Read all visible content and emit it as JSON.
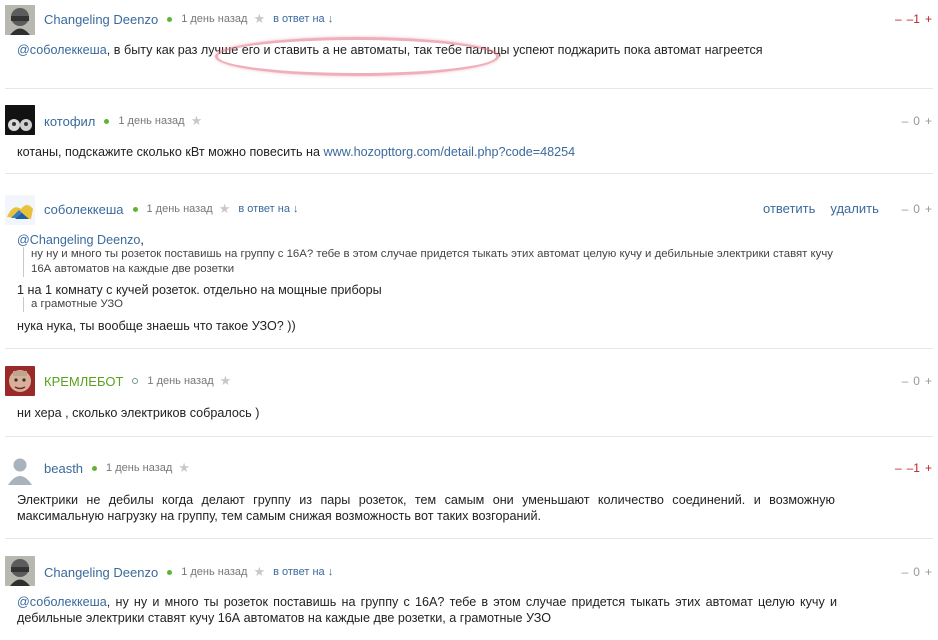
{
  "comments": [
    {
      "author": "Changeling Deenzo",
      "time": "1 день назад",
      "reply_label": "в ответ на ↓",
      "rating": "–1",
      "minus": "–",
      "plus": "+",
      "mention": "@соболеккеша",
      "text": ", в быту как раз лучше его и ставить а не автоматы, так тебе пальцы успеют поджарить пока автомат нагреется"
    },
    {
      "author": "котофил",
      "time": "1 день назад",
      "rating": "0",
      "minus": "–",
      "plus": "+",
      "text": "котаны, подскажите сколько кВт можно повесить на ",
      "link": "www.hozopttorg.com/detail.php?code=48254"
    },
    {
      "author": "соболеккеша",
      "time": "1 день назад",
      "reply_label": "в ответ на ↓",
      "reply_action": "ответить",
      "delete_action": "удалить",
      "rating": "0",
      "minus": "–",
      "plus": "+",
      "mention": "@Changeling Deenzo",
      "quote1": "ну ну и много ты розеток поставишь на группу с 16А? тебе в этом случае придется тыкать этих автомат целую кучу и дебильные электрики ставят кучу 16А автоматов на каждые две розетки",
      "line2": "1 на 1 комнату с кучей розеток. отдельно на мощные приборы",
      "quote2": "а грамотные УЗО",
      "line3": "нука нука, ты вообще знаешь что такое УЗО? ))"
    },
    {
      "author": "КРЕМЛЕБОТ",
      "time": "1 день назад",
      "rating": "0",
      "minus": "–",
      "plus": "+",
      "text": "ни хера , сколько электриков собралось )"
    },
    {
      "author": "beasth",
      "time": "1 день назад",
      "rating": "–1",
      "minus": "–",
      "plus": "+",
      "text": "Электрики не дебилы когда делают группу из пары розеток, тем самым они уменьшают количество соединений. и возможную максимальную нагрузку на группу, тем самым снижая возможность вот таких возгораний."
    },
    {
      "author": "Changeling Deenzo",
      "time": "1 день назад",
      "reply_label": "в ответ на ↓",
      "rating": "0",
      "minus": "–",
      "plus": "+",
      "mention": "@соболеккеша",
      "text": ", ну ну и много ты розеток поставишь на группу с 16А? тебе в этом случае придется тыкать этих автомат целую кучу и дебильные электрики ставят кучу 16А автоматов на каждые две розетки, а грамотные УЗО"
    }
  ],
  "colors": {
    "link": "#3a6a9c",
    "negative": "#c0232a",
    "online_dot": "#5fb533",
    "highlight_ellipse": "#e26e82"
  },
  "icons": [
    "star-icon",
    "online-dot-icon",
    "avatar-icon"
  ]
}
